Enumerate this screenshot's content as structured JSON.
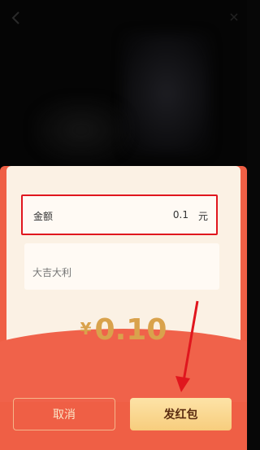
{
  "amount_row": {
    "label": "金额",
    "value": "0.1",
    "unit": "元"
  },
  "message": {
    "placeholder": "大吉大利"
  },
  "total": {
    "currency": "¥",
    "value": "0.10"
  },
  "buttons": {
    "cancel_label": "取消",
    "send_label": "发红包"
  },
  "colors": {
    "envelope_red": "#ef5f45",
    "card_cream": "#fbf1e4",
    "highlight_border": "#e0161e",
    "amount_gold": "#d9a24c",
    "send_button": "#f7cd7d"
  },
  "icons": {
    "back": "chevron-left-icon",
    "top_right": "close-icon"
  }
}
